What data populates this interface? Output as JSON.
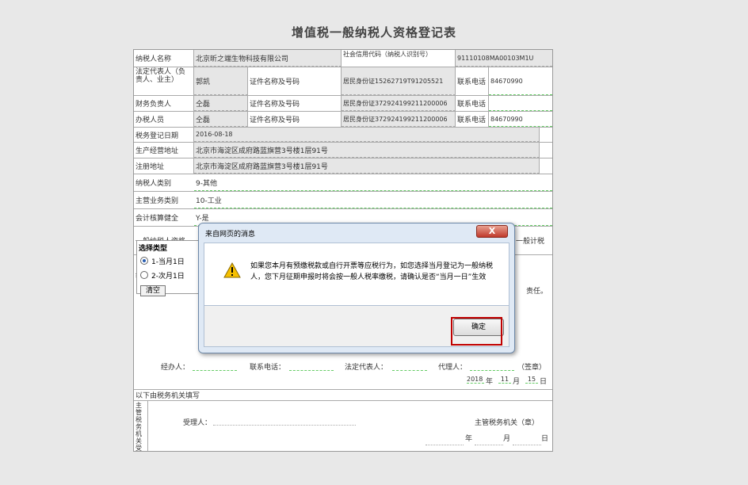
{
  "title": "增值税一般纳税人资格登记表",
  "rows": {
    "r1": {
      "l1": "纳税人名称",
      "v1": "北京昕之端生物科技有限公司",
      "l2": "社会信用代码（纳税人识别号）",
      "v2": "91110108MA00103M1U"
    },
    "r2": {
      "l1": "法定代表人（负责人、业主）",
      "v1": "郭凯",
      "l2": "证件名称及号码",
      "v2": "居民身份证15262719T91205521",
      "l3": "联系电话",
      "v3": "84670990"
    },
    "r3": {
      "l1": "财务负责人",
      "v1": "仝磊",
      "l2": "证件名称及号码",
      "v2": "居民身份证372924199211200006",
      "l3": "联系电话",
      "v3": ""
    },
    "r4": {
      "l1": "办税人员",
      "v1": "仝磊",
      "l2": "证件名称及号码",
      "v2": "居民身份证372924199211200006",
      "l3": "联系电话",
      "v3": "84670990"
    },
    "r5": {
      "l1": "税务登记日期",
      "v1": "2016-08-18"
    },
    "r6": {
      "l1": "生产经营地址",
      "v1": "北京市海淀区成府路蓝旗营3号楼1层91号"
    },
    "r7": {
      "l1": "注册地址",
      "v1": "北京市海淀区成府路蓝旗营3号楼1层91号"
    },
    "r8": {
      "l1": "纳税人类别",
      "v1": "9-其他"
    },
    "r9": {
      "l1": "主营业务类别",
      "v1": "10-工业"
    },
    "r10": {
      "l1": "会计核算健全",
      "v1": "Y-是"
    },
    "r11": {
      "l1": "一般纳税人资格",
      "v1": "一般计税"
    }
  },
  "select_panel": {
    "title": "选择类型",
    "opt1": "1-当月1日",
    "opt2": "2-次月1日",
    "clear": "清空"
  },
  "partial": {
    "na": "纳",
    "duty": "责任。"
  },
  "sign": {
    "agent": "经办人：",
    "phone": "联系电话：",
    "rep": "法定代表人：",
    "proxy": "代理人：",
    "seal": "（签章）",
    "year": "2018",
    "year_u": "年",
    "month": "11",
    "month_u": "月",
    "day": "15",
    "day_u": "日"
  },
  "tax_section": {
    "header": "以下由税务机关填写",
    "side": "主管税务机关受理情况",
    "receiver": "受理人：",
    "authority": "主管税务机关（章）",
    "y": "年",
    "m": "月",
    "d": "日"
  },
  "dialog": {
    "title": "来自网页的消息",
    "close": "X",
    "message": "如果您本月有预缴税款或自行开票等应税行为，如您选择当月登记为一般纳税人，您下月征期申报时将会按一般人税率缴税，请确认是否“当月一日”生效",
    "ok": "确定"
  }
}
